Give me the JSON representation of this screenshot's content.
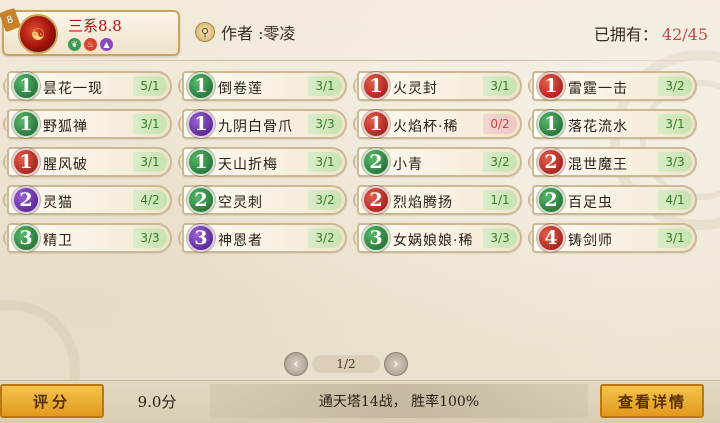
{
  "header": {
    "corner_tag": "8",
    "deck_name": "三系8.8",
    "elements": [
      {
        "name": "leaf-icon",
        "glyph": "❦",
        "color": "green"
      },
      {
        "name": "flame-icon",
        "glyph": "♨",
        "color": "red"
      },
      {
        "name": "triangle-icon",
        "glyph": "▲",
        "color": "purple"
      }
    ],
    "author_label": "作者 :零凌",
    "owned_label": "已拥有：",
    "owned_count": "42/45"
  },
  "cards": [
    {
      "cost": "1",
      "color": "green",
      "name": "昙花一现",
      "qty": "5/1",
      "warn": false
    },
    {
      "cost": "1",
      "color": "green",
      "name": "倒卷莲",
      "qty": "3/1",
      "warn": false
    },
    {
      "cost": "1",
      "color": "red",
      "name": "火灵封",
      "qty": "3/1",
      "warn": false
    },
    {
      "cost": "1",
      "color": "red",
      "name": "雷霆一击",
      "qty": "3/2",
      "warn": false
    },
    {
      "cost": "1",
      "color": "green",
      "name": "野狐禅",
      "qty": "3/1",
      "warn": false
    },
    {
      "cost": "1",
      "color": "purple",
      "name": "九阴白骨爪",
      "qty": "3/3",
      "warn": false
    },
    {
      "cost": "1",
      "color": "red",
      "name": "火焰杯·稀",
      "qty": "0/2",
      "warn": true
    },
    {
      "cost": "1",
      "color": "green",
      "name": "落花流水",
      "qty": "3/1",
      "warn": false
    },
    {
      "cost": "1",
      "color": "red",
      "name": "腥风破",
      "qty": "3/1",
      "warn": false
    },
    {
      "cost": "1",
      "color": "green",
      "name": "天山折梅",
      "qty": "3/1",
      "warn": false
    },
    {
      "cost": "2",
      "color": "green",
      "name": "小青",
      "qty": "3/2",
      "warn": false
    },
    {
      "cost": "2",
      "color": "red",
      "name": "混世魔王",
      "qty": "3/3",
      "warn": false
    },
    {
      "cost": "2",
      "color": "purple",
      "name": "灵猫",
      "qty": "4/2",
      "warn": false
    },
    {
      "cost": "2",
      "color": "green",
      "name": "空灵刺",
      "qty": "3/2",
      "warn": false
    },
    {
      "cost": "2",
      "color": "red",
      "name": "烈焰腾扬",
      "qty": "1/1",
      "warn": false
    },
    {
      "cost": "2",
      "color": "green",
      "name": "百足虫",
      "qty": "4/1",
      "warn": false
    },
    {
      "cost": "3",
      "color": "green",
      "name": "精卫",
      "qty": "3/3",
      "warn": false
    },
    {
      "cost": "3",
      "color": "purple",
      "name": "神恩者",
      "qty": "3/2",
      "warn": false
    },
    {
      "cost": "3",
      "color": "green",
      "name": "女娲娘娘·稀",
      "qty": "3/3",
      "warn": false
    },
    {
      "cost": "4",
      "color": "red",
      "name": "铸剑师",
      "qty": "3/1",
      "warn": false
    }
  ],
  "pager": {
    "label": "1/2",
    "prev_glyph": "‹",
    "next_glyph": "›"
  },
  "footer": {
    "score_button": "评分",
    "score_value": "9.0分",
    "record_text": "通天塔14战， 胜率100%",
    "detail_button": "查看详情"
  }
}
